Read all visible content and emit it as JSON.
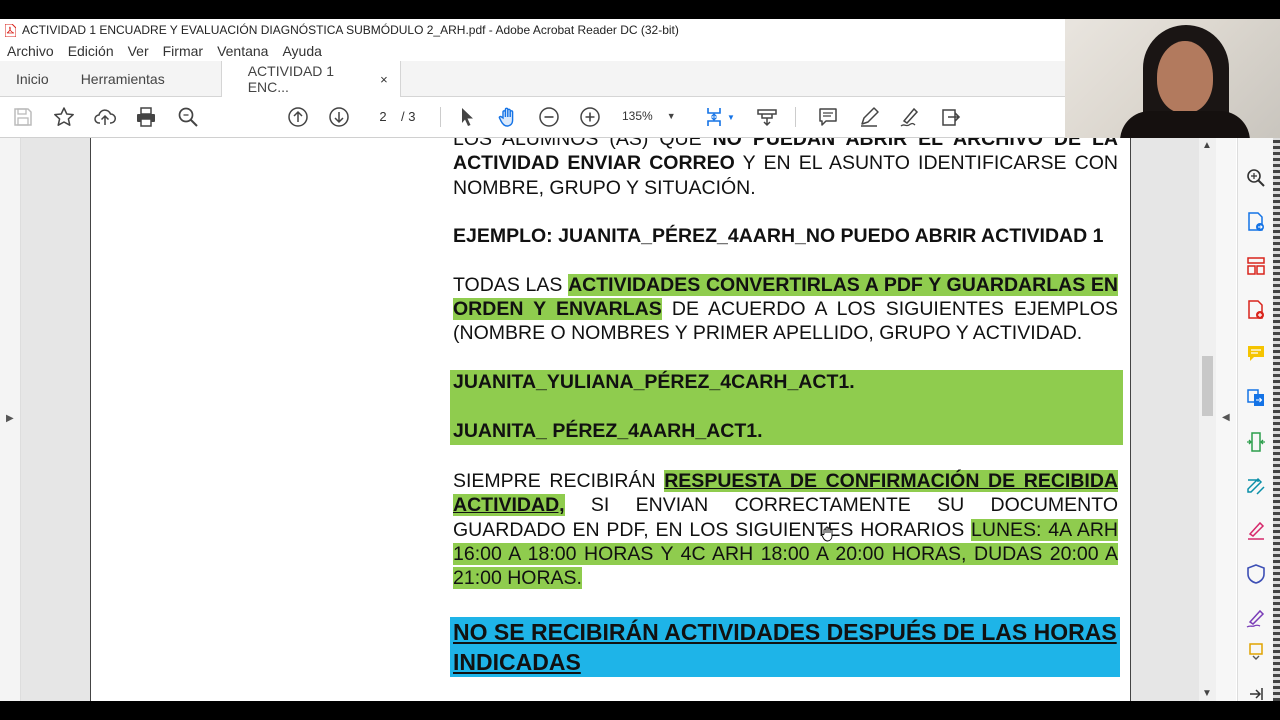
{
  "window": {
    "title": "ACTIVIDAD 1 ENCUADRE Y EVALUACIÓN DIAGNÓSTICA SUBMÓDULO 2_ARH.pdf - Adobe Acrobat Reader DC (32-bit)"
  },
  "menu": [
    "Archivo",
    "Edición",
    "Ver",
    "Firmar",
    "Ventana",
    "Ayuda"
  ],
  "tabs": {
    "home": "Inicio",
    "tools": "Herramientas",
    "document": "ACTIVIDAD 1 ENC...",
    "close": "×"
  },
  "toolbar": {
    "current_page": "2",
    "page_total": "/ 3",
    "zoom": "135%"
  },
  "document": {
    "p1_line_top": "LOS ALUMNOS (AS) QUE ",
    "p1_bold_top": "NO PUEDAN ABRIR EL ARCHIVO DE LA",
    "p1_bold": "ACTIVIDAD ENVIAR CORREO",
    "p1_rest": " Y EN EL ASUNTO IDENTIFICARSE CON NOMBRE, GRUPO Y SITUACIÓN.",
    "example": "EJEMPLO: JUANITA_PÉREZ_4AARH_NO PUEDO ABRIR ACTIVIDAD 1",
    "p3_start": "TODAS LAS ",
    "p3_highlight": "ACTIVIDADES CONVERTIRLAS A PDF Y GUARDARLAS EN ORDEN Y ENVARLAS",
    "p3_rest": " DE ACUERDO A LOS SIGUIENTES EJEMPLOS (NOMBRE O NOMBRES Y PRIMER APELLIDO, GRUPO Y ACTIVIDAD.",
    "file_example_1": "JUANITA_YULIANA_PÉREZ_4CARH_ACT1.",
    "file_example_2": "JUANITA_ PÉREZ_4AARH_ACT1.",
    "p4_start": "SIEMPRE RECIBIRÁN ",
    "p4_highlight": "RESPUESTA DE CONFIRMACIÓN DE RECIBIDA ACTIVIDAD,",
    "p4_mid": " SI ENVIAN CORRECTAMENTE SU DOCUMENTO GUARDADO EN PDF, EN LOS SIGUIENTES HORARIOS ",
    "p4_schedule": "LUNES: 4A ARH 16:00 A 18:00 HORAS Y 4C ARH 18:00 A 20:00 HORAS, DUDAS 20:00 A 21:00 HORAS.",
    "warning": "NO SE RECIBIRÁN ACTIVIDADES DESPUÉS DE LAS HORAS INDICADAS"
  },
  "icons": {
    "toolbar": [
      "save-icon",
      "star-icon",
      "cloud-upload-icon",
      "print-icon",
      "search-icon",
      "page-up-icon",
      "page-down-icon",
      "select-pointer-icon",
      "hand-icon",
      "zoom-out-icon",
      "zoom-in-icon",
      "fit-page-icon",
      "scroll-mode-icon",
      "comment-icon",
      "pen-icon",
      "sign-icon",
      "share-icon"
    ],
    "right_panel": [
      "find-icon",
      "export-pdf-icon",
      "organize-pages-icon",
      "create-pdf-icon",
      "comment-tool-icon",
      "combine-files-icon",
      "compress-pdf-icon",
      "edit-pdf-icon",
      "fill-sign-icon",
      "protect-icon",
      "sign-tool-icon",
      "more-tools-icon",
      "collapse-panel-icon"
    ]
  },
  "colors": {
    "highlight_green": "#8fcc4e",
    "highlight_blue": "#1eb4e8",
    "acrobat_red": "#d9241c",
    "tool_blue": "#1473e6"
  }
}
